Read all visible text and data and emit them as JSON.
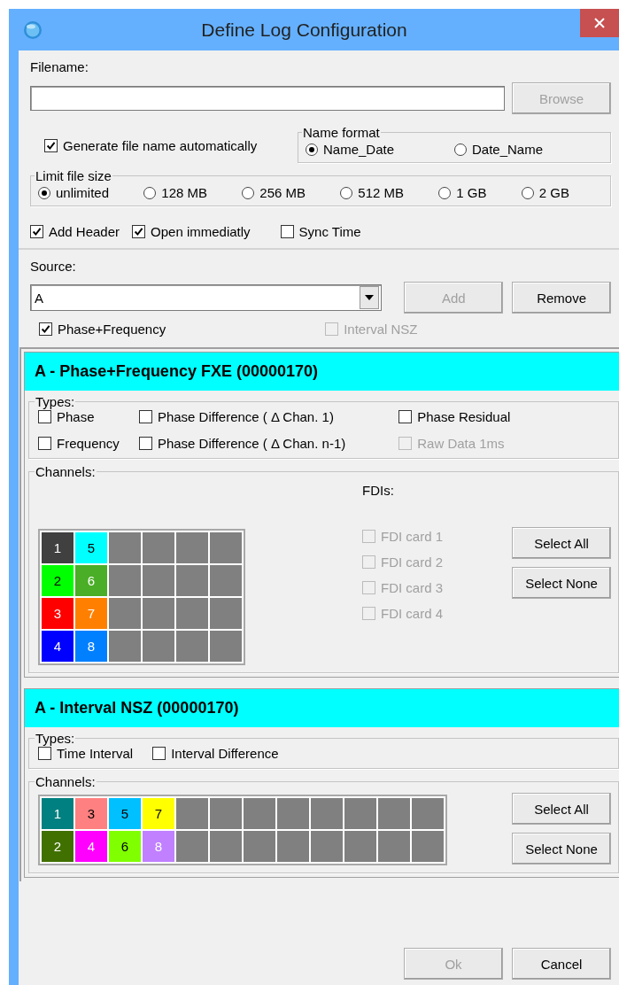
{
  "window": {
    "title": "Define Log Configuration"
  },
  "filename": {
    "label": "Filename:"
  },
  "browse_button": {
    "label": "Browse",
    "disabled": true
  },
  "auto_name": {
    "label": "Generate file name automatically",
    "checked": true
  },
  "name_format": {
    "title": "Name format",
    "options": [
      {
        "label": "Name_Date",
        "selected": true
      },
      {
        "label": "Date_Name",
        "selected": false
      }
    ]
  },
  "limit_file_size": {
    "title": "Limit file size",
    "options": [
      {
        "label": "unlimited",
        "selected": true
      },
      {
        "label": "128 MB",
        "selected": false
      },
      {
        "label": "256 MB",
        "selected": false
      },
      {
        "label": "512 MB",
        "selected": false
      },
      {
        "label": "1 GB",
        "selected": false
      },
      {
        "label": "2 GB",
        "selected": false
      }
    ]
  },
  "options": [
    {
      "label": "Add Header",
      "checked": true
    },
    {
      "label": "Open immediatly",
      "checked": true
    },
    {
      "label": "Sync Time",
      "checked": false
    }
  ],
  "source": {
    "label": "Source:",
    "value": "A",
    "add_button": {
      "label": "Add",
      "disabled": true
    },
    "remove_button": {
      "label": "Remove",
      "disabled": false
    },
    "types": [
      {
        "label": "Phase+Frequency",
        "checked": true,
        "disabled": false
      },
      {
        "label": "Interval NSZ",
        "checked": false,
        "disabled": true
      }
    ]
  },
  "sections": [
    {
      "title": "A - Phase+Frequency FXE (00000170)",
      "types_label": "Types:",
      "type_columns": [
        [
          {
            "label": "Phase",
            "checked": false,
            "disabled": false
          },
          {
            "label": "Frequency",
            "checked": false,
            "disabled": false
          }
        ],
        [
          {
            "label": "Phase Difference ( Δ Chan. 1)",
            "checked": false,
            "disabled": false
          },
          {
            "label": "Phase Difference ( Δ Chan. n-1)",
            "checked": false,
            "disabled": false
          }
        ],
        [
          {
            "label": "Phase Residual",
            "checked": false,
            "disabled": false
          },
          {
            "label": "Raw Data 1ms",
            "checked": false,
            "disabled": true
          }
        ]
      ],
      "channels_label": "Channels:",
      "grid": [
        [
          {
            "label": "1",
            "color": "#404040",
            "light_text": true
          },
          {
            "label": "5",
            "color": "#00ffff",
            "light_text": false
          },
          {
            "kind": "empty"
          },
          {
            "kind": "empty"
          },
          {
            "kind": "empty"
          },
          {
            "kind": "empty"
          }
        ],
        [
          {
            "label": "2",
            "color": "#00ff00",
            "light_text": false
          },
          {
            "label": "6",
            "color": "#4aae26",
            "light_text": true
          },
          {
            "kind": "empty"
          },
          {
            "kind": "empty"
          },
          {
            "kind": "empty"
          },
          {
            "kind": "empty"
          }
        ],
        [
          {
            "label": "3",
            "color": "#ff0000",
            "light_text": true
          },
          {
            "label": "7",
            "color": "#ff8000",
            "light_text": true
          },
          {
            "kind": "empty"
          },
          {
            "kind": "empty"
          },
          {
            "kind": "empty"
          },
          {
            "kind": "empty"
          }
        ],
        [
          {
            "label": "4",
            "color": "#0000ff",
            "light_text": true
          },
          {
            "label": "8",
            "color": "#0080ff",
            "light_text": true
          },
          {
            "kind": "empty"
          },
          {
            "kind": "empty"
          },
          {
            "kind": "empty"
          },
          {
            "kind": "empty"
          }
        ]
      ],
      "fdis": {
        "label": "FDIs:",
        "items": [
          {
            "label": "FDI card 1",
            "checked": false,
            "disabled": true
          },
          {
            "label": "FDI card 2",
            "checked": false,
            "disabled": true
          },
          {
            "label": "FDI card 3",
            "checked": false,
            "disabled": true
          },
          {
            "label": "FDI card 4",
            "checked": false,
            "disabled": true
          }
        ]
      },
      "buttons": [
        {
          "label": "Select All"
        },
        {
          "label": "Select None"
        }
      ]
    },
    {
      "title": "A - Interval NSZ (00000170)",
      "types_label": "Types:",
      "type_columns": [
        [
          {
            "label": "Time Interval",
            "checked": false,
            "disabled": false
          }
        ],
        [
          {
            "label": "Interval Difference",
            "checked": false,
            "disabled": false
          }
        ]
      ],
      "channels_label": "Channels:",
      "grid": [
        [
          {
            "label": "1",
            "color": "#008080",
            "light_text": true
          },
          {
            "label": "3",
            "color": "#ff8080",
            "light_text": false
          },
          {
            "label": "5",
            "color": "#00c0ff",
            "light_text": false
          },
          {
            "label": "7",
            "color": "#ffff00",
            "light_text": false
          },
          {
            "kind": "empty"
          },
          {
            "kind": "empty"
          },
          {
            "kind": "empty"
          },
          {
            "kind": "empty"
          },
          {
            "kind": "empty"
          },
          {
            "kind": "empty"
          },
          {
            "kind": "empty"
          },
          {
            "kind": "empty"
          }
        ],
        [
          {
            "label": "2",
            "color": "#407000",
            "light_text": true
          },
          {
            "label": "4",
            "color": "#ff00ff",
            "light_text": true
          },
          {
            "label": "6",
            "color": "#80ff00",
            "light_text": false
          },
          {
            "label": "8",
            "color": "#c080ff",
            "light_text": true
          },
          {
            "kind": "empty"
          },
          {
            "kind": "empty"
          },
          {
            "kind": "empty"
          },
          {
            "kind": "empty"
          },
          {
            "kind": "empty"
          },
          {
            "kind": "empty"
          },
          {
            "kind": "empty"
          },
          {
            "kind": "empty"
          }
        ]
      ],
      "buttons": [
        {
          "label": "Select All"
        },
        {
          "label": "Select None"
        }
      ]
    }
  ],
  "footer": {
    "buttons": [
      {
        "label": "Ok",
        "disabled": true
      },
      {
        "label": "Cancel",
        "disabled": false
      }
    ]
  }
}
